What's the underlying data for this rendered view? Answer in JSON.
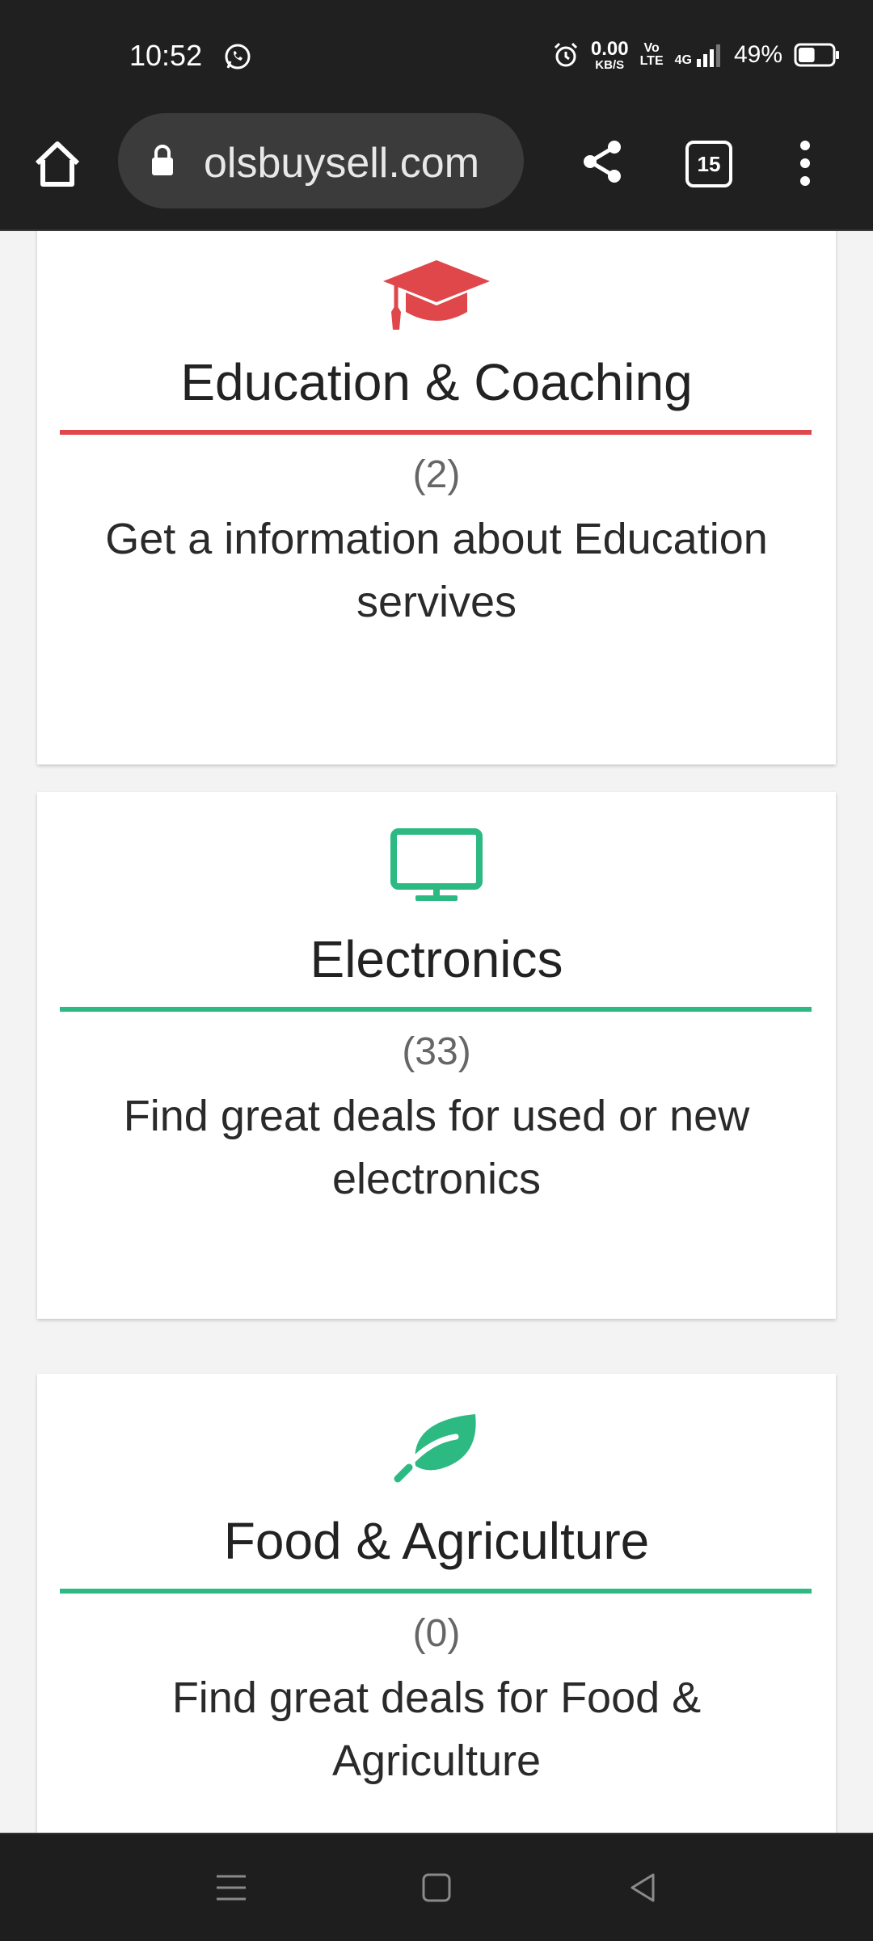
{
  "status_bar": {
    "time": "10:52",
    "speed_value": "0.00",
    "speed_unit": "KB/S",
    "volte_top": "Vo",
    "volte_bottom": "LTE",
    "network": "4G",
    "battery_text": "49%",
    "battery_level": 0.49,
    "icons": [
      "whatsapp-icon",
      "alarm-icon",
      "signal-icon",
      "battery-icon"
    ]
  },
  "toolbar": {
    "url": "olsbuysell.com",
    "tab_count": "15",
    "icons": [
      "home-icon",
      "lock-icon",
      "share-icon",
      "menu-dots-icon"
    ]
  },
  "categories": [
    {
      "title": "Education & Coaching",
      "count": "(2)",
      "description": "Get a information about Education servives",
      "icon": "graduation-cap-icon",
      "color": "#e0474a"
    },
    {
      "title": "Electronics",
      "count": "(33)",
      "description": "Find great deals for used or new electronics",
      "icon": "monitor-icon",
      "color": "#2cba82"
    },
    {
      "title": "Food & Agriculture",
      "count": "(0)",
      "description": "Find great deals for Food & Agriculture",
      "icon": "leaf-icon",
      "color": "#2cba82"
    }
  ],
  "nav_bar": {
    "icons": [
      "recents-menu-icon",
      "home-square-icon",
      "back-triangle-icon"
    ]
  }
}
